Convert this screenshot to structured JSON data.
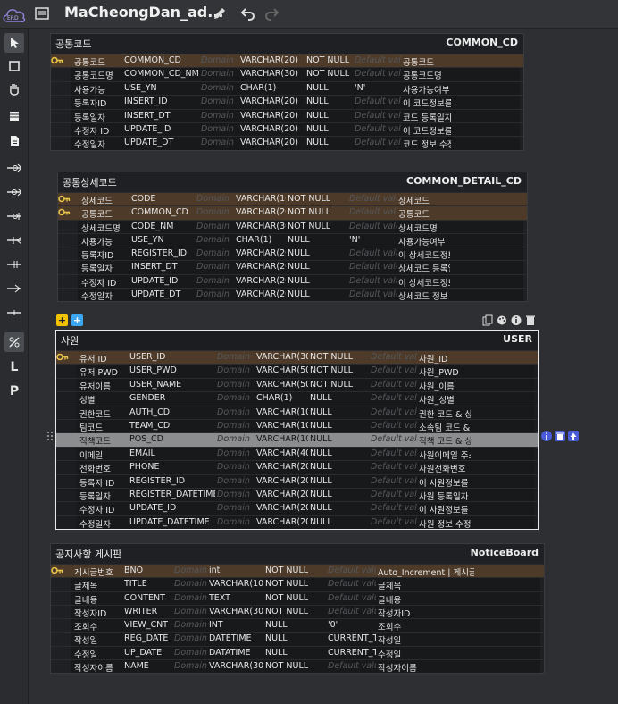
{
  "app": {
    "title": "MaCheongDan_ad...",
    "logo_text": "ERD"
  },
  "toolbar": {
    "edit_icon": "pencil-icon",
    "undo_icon": "undo-icon",
    "redo_icon": "redo-icon"
  },
  "sidebar": [
    "pointer",
    "select-box",
    "hand",
    "table",
    "note",
    "one-one",
    "one-many",
    "one-zero-one",
    "zero-many",
    "one-only",
    "zero-one",
    "line",
    "non-identifying",
    "identifying-L",
    "identifying-P"
  ],
  "tables": [
    {
      "logical": "공통코드",
      "physical": "COMMON_CD",
      "rows": [
        [
          "공통코드",
          "COMMON_CD",
          "Domain",
          "VARCHAR(20)",
          "NOT NULL",
          "Default value",
          "공통코드",
          true
        ],
        [
          "공통코드명",
          "COMMON_CD_NM",
          "Domain",
          "VARCHAR(30)",
          "NOT NULL",
          "Default value",
          "공통코드명",
          false
        ],
        [
          "사용가능",
          "USE_YN",
          "Domain",
          "CHAR(1)",
          "NULL",
          "'N'",
          "사용가능여부",
          false
        ],
        [
          "등록자ID",
          "INSERT_ID",
          "Domain",
          "VARCHAR(20)",
          "NULL",
          "Default value",
          "이 코드정보를 등록한 유저ID",
          false
        ],
        [
          "등록일자",
          "INSERT_DT",
          "Domain",
          "VARCHAR(20)",
          "NULL",
          "Default value",
          "코드 등록일자",
          false
        ],
        [
          "수정자 ID",
          "UPDATE_ID",
          "Domain",
          "VARCHAR(20)",
          "NULL",
          "Default value",
          "이 코드정보를 수정한 유저ID",
          false
        ],
        [
          "수정일자",
          "UPDATE_DT",
          "Domain",
          "VARCHAR(20)",
          "NULL",
          "Default value",
          "코드 정보 수정일자",
          false
        ]
      ]
    },
    {
      "logical": "공통상세코드",
      "physical": "COMMON_DETAIL_CD",
      "rows": [
        [
          "상세코드",
          "CODE",
          "Domain",
          "VARCHAR(10)",
          "NOT NULL",
          "Default value",
          "상세코드",
          true
        ],
        [
          "공통코드",
          "COMMON_CD",
          "Domain",
          "VARCHAR(20)",
          "NOT NULL",
          "Default value",
          "공통코드",
          true
        ],
        [
          "상세코드명",
          "CODE_NM",
          "Domain",
          "VARCHAR(30)",
          "NOT NULL",
          "Default value",
          "상세코드명",
          false
        ],
        [
          "사용가능",
          "USE_YN",
          "Domain",
          "CHAR(1)",
          "NULL",
          "'N'",
          "사용가능여부",
          false
        ],
        [
          "등록자ID",
          "REGISTER_ID",
          "Domain",
          "VARCHAR(20)",
          "NULL",
          "Default value",
          "이 상세코드정보를 등록한 유저ID",
          false
        ],
        [
          "등록일자",
          "INSERT_DT",
          "Domain",
          "VARCHAR(20)",
          "NULL",
          "Default value",
          "상세코드 등록일자",
          false
        ],
        [
          "수정자 ID",
          "UPDATE_ID",
          "Domain",
          "VARCHAR(20)",
          "NULL",
          "Default value",
          "이 상세코드정보를 수정한 유저ID",
          false
        ],
        [
          "수정일자",
          "UPDATE_DT",
          "Domain",
          "VARCHAR(20)",
          "NULL",
          "Default value",
          "상세코드 정보 수정일자",
          false
        ]
      ]
    },
    {
      "logical": "사원",
      "physical": "USER",
      "rows": [
        [
          "유저 ID",
          "USER_ID",
          "Domain",
          "VARCHAR(30)",
          "NOT NULL",
          "Default value",
          "사원_ID",
          true
        ],
        [
          "유저 PWD",
          "USER_PWD",
          "Domain",
          "VARCHAR(50)",
          "NOT NULL",
          "Default value",
          "사원_PWD",
          false
        ],
        [
          "유저이름",
          "USER_NAME",
          "Domain",
          "VARCHAR(50)",
          "NOT NULL",
          "Default value",
          "사원_이름",
          false
        ],
        [
          "성별",
          "GENDER",
          "Domain",
          "CHAR(1)",
          "NULL",
          "Default value",
          "사원_성별",
          false
        ],
        [
          "권한코드",
          "AUTH_CD",
          "Domain",
          "VARCHAR(10)",
          "NULL",
          "Default value",
          "권한 코드 & 상세 코드",
          false
        ],
        [
          "팀코드",
          "TEAM_CD",
          "Domain",
          "VARCHAR(10)",
          "NULL",
          "Default value",
          "소속팀 코드 & 상세 코드",
          false
        ],
        [
          "직책코드",
          "POS_CD",
          "Domain",
          "VARCHAR(10)",
          "NULL",
          "Default value",
          "직책 코드 & 상세 코드",
          false
        ],
        [
          "이메일",
          "EMAIL",
          "Domain",
          "VARCHAR(40)",
          "NULL",
          "Default value",
          "사원이메일 주소",
          false
        ],
        [
          "전화번호",
          "PHONE",
          "Domain",
          "VARCHAR(20)",
          "NULL",
          "Default value",
          "사원전화번호",
          false
        ],
        [
          "등록자 ID",
          "REGISTER_ID",
          "Domain",
          "VARCHAR(20)",
          "NULL",
          "Default value",
          "이 사원정보를 등록한 사원ID",
          false
        ],
        [
          "등록일자",
          "REGISTER_DATETIME",
          "Domain",
          "VARCHAR(20)",
          "NULL",
          "Default value",
          "사원 등록일자",
          false
        ],
        [
          "수정자 ID",
          "UPDATE_ID",
          "Domain",
          "VARCHAR(20)",
          "NULL",
          "Default value",
          "이 사원정보를 수정한 사원ID",
          false
        ],
        [
          "수정일자",
          "UPDATE_DATETIME",
          "Domain",
          "VARCHAR(20)",
          "NULL",
          "Default value",
          "사원 정보 수정일자",
          false
        ]
      ]
    },
    {
      "logical": "공지사항 게시판",
      "physical": "NoticeBoard",
      "rows": [
        [
          "게시글번호",
          "BNO",
          "Domain",
          "int",
          "NOT NULL",
          "Default value",
          "Auto_Increment | 게시글번호",
          true
        ],
        [
          "글제목",
          "TITLE",
          "Domain",
          "VARCHAR(100)",
          "NOT NULL",
          "Default value",
          "글제목",
          false
        ],
        [
          "글내용",
          "CONTENT",
          "Domain",
          "TEXT",
          "NOT NULL",
          "Default value",
          "글내용",
          false
        ],
        [
          "작성자ID",
          "WRITER",
          "Domain",
          "VARCHAR(30)",
          "NOT NULL",
          "Default value",
          "작성자ID",
          false
        ],
        [
          "조회수",
          "VIEW_CNT",
          "Domain",
          "INT",
          "NULL",
          "'0'",
          "조회수",
          false
        ],
        [
          "작성일",
          "REG_DATE",
          "Domain",
          "DATETIME",
          "NULL",
          "CURRENT_TIMESTAMP",
          "작성일",
          false
        ],
        [
          "수정일",
          "UP_DATE",
          "Domain",
          "DATATIME",
          "NULL",
          "CURRENT_TIMESTAMP",
          "수정일",
          false
        ],
        [
          "작성자이름",
          "NAME",
          "Domain",
          "VARCHAR(30)",
          "NOT NULL",
          "Default value",
          "작성자이름",
          false
        ]
      ]
    }
  ],
  "selected_row": {
    "table": 2,
    "row": 6
  },
  "colors": {
    "pk_row": "#4e3a28",
    "selected_row": "#8c8d8f",
    "accent_blue": "#4a5bd8",
    "accent_yellow": "#f2c200"
  }
}
